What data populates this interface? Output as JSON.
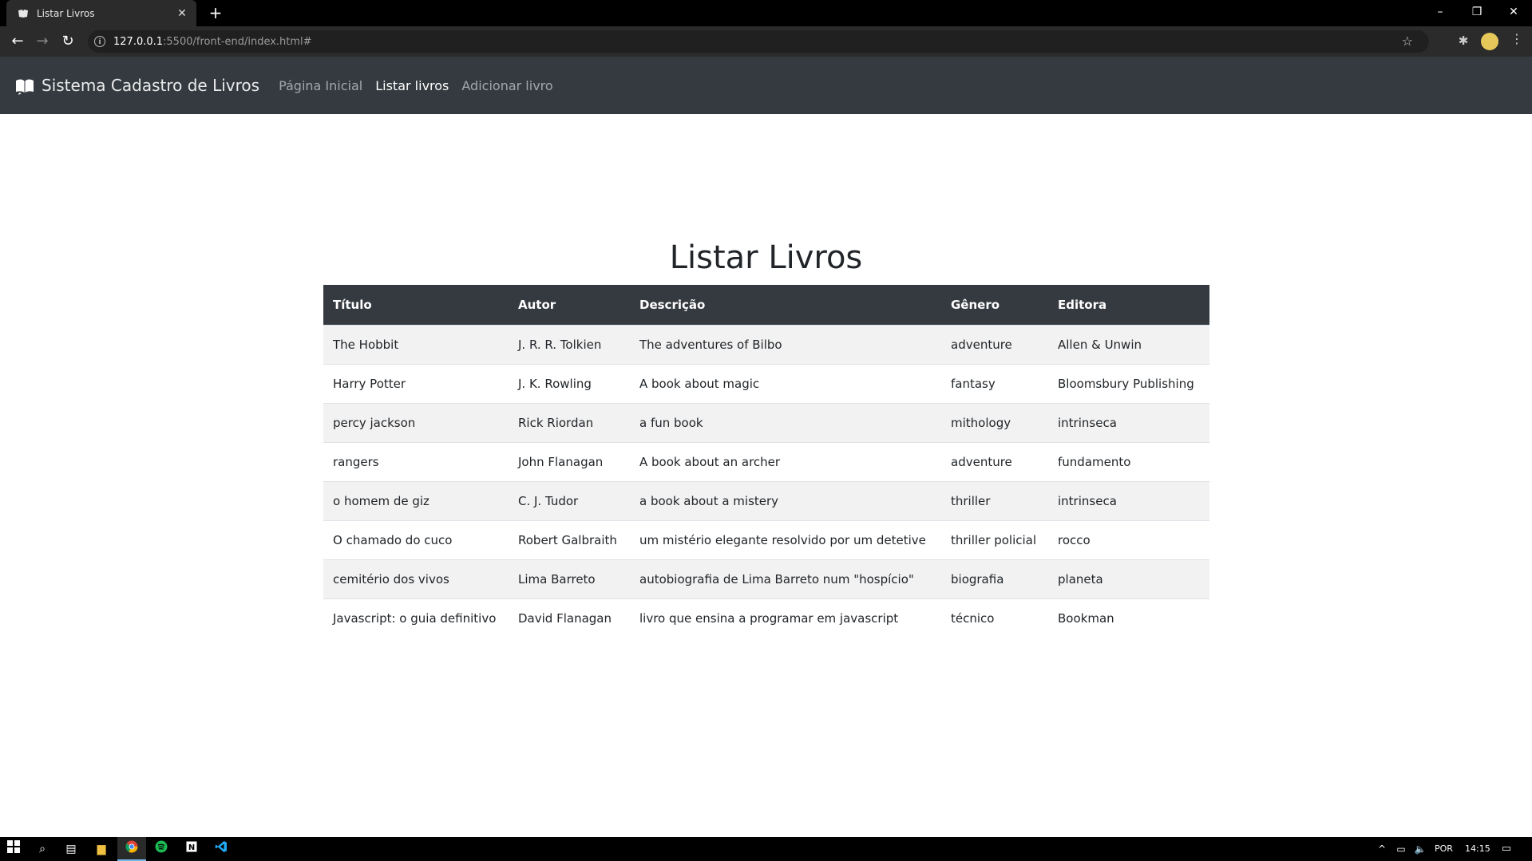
{
  "browser": {
    "tab_title": "Listar Livros",
    "url_host": "127.0.0.1",
    "url_rest": ":5500/front-end/index.html#"
  },
  "navbar": {
    "brand": "Sistema Cadastro de Livros",
    "links": [
      "Página Inicial",
      "Listar livros",
      "Adicionar livro"
    ]
  },
  "page": {
    "title": "Listar Livros"
  },
  "table": {
    "headers": [
      "Título",
      "Autor",
      "Descrição",
      "Gênero",
      "Editora"
    ],
    "rows": [
      [
        "The Hobbit",
        "J. R. R. Tolkien",
        "The adventures of Bilbo",
        "adventure",
        "Allen & Unwin"
      ],
      [
        "Harry Potter",
        "J. K. Rowling",
        "A book about magic",
        "fantasy",
        "Bloomsbury Publishing"
      ],
      [
        "percy jackson",
        "Rick Riordan",
        "a fun book",
        "mithology",
        "intrinseca"
      ],
      [
        "rangers",
        "John Flanagan",
        "A book about an archer",
        "adventure",
        "fundamento"
      ],
      [
        "o homem de giz",
        "C. J. Tudor",
        "a book about a mistery",
        "thriller",
        "intrinseca"
      ],
      [
        "O chamado do cuco",
        "Robert Galbraith",
        "um mistério elegante resolvido por um detetive",
        "thriller policial",
        "rocco"
      ],
      [
        "cemitério dos vivos",
        "Lima Barreto",
        "autobiografia de Lima Barreto num \"hospício\"",
        "biografia",
        "planeta"
      ],
      [
        "Javascript: o guia definitivo",
        "David Flanagan",
        "livro que ensina a programar em javascript",
        "técnico",
        "Bookman"
      ]
    ]
  },
  "taskbar": {
    "language": "POR",
    "time": "14:15"
  },
  "colors": {
    "navbar_bg": "#343a40",
    "table_header_bg": "#343a40",
    "striped_row_bg": "#f2f2f2"
  }
}
